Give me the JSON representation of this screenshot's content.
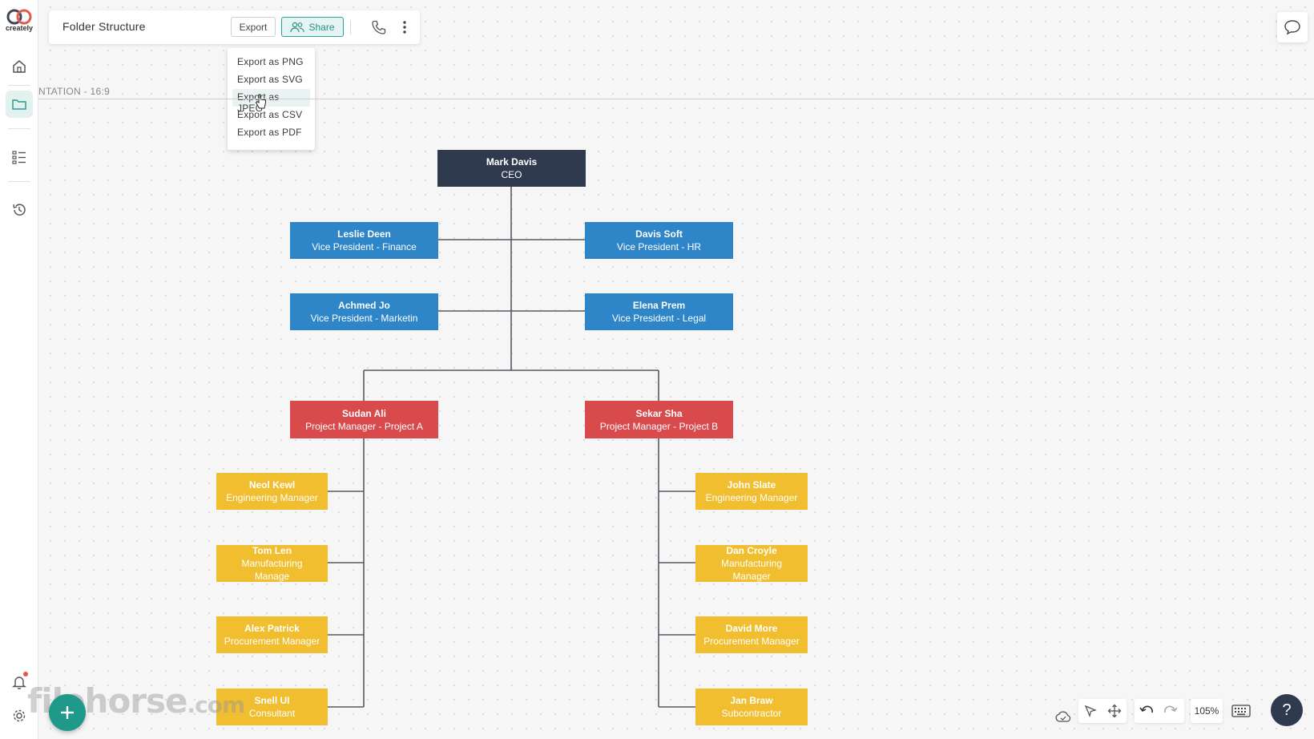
{
  "app": {
    "logo_text": "creately",
    "brand_color": "#1f9a8a"
  },
  "toolbar": {
    "title": "Folder Structure",
    "export_label": "Export",
    "share_label": "Share"
  },
  "export_menu": {
    "items": [
      {
        "label": "Export as PNG"
      },
      {
        "label": "Export as SVG"
      },
      {
        "label": "Export as JPEG",
        "hovered": true
      },
      {
        "label": "Export as CSV"
      },
      {
        "label": "Export as PDF"
      }
    ]
  },
  "canvas": {
    "presentation_label": "NTATION - 16:9"
  },
  "org_chart": {
    "ceo": {
      "name": "Mark Davis",
      "title": "CEO"
    },
    "vps": [
      {
        "name": "Leslie Deen",
        "title": "Vice President - Finance"
      },
      {
        "name": "Davis Soft",
        "title": "Vice President - HR"
      },
      {
        "name": "Achmed Jo",
        "title": "Vice President - Marketin"
      },
      {
        "name": "Elena Prem",
        "title": "Vice President - Legal"
      }
    ],
    "pms": [
      {
        "name": "Sudan Ali",
        "title": "Project Manager - Project A"
      },
      {
        "name": "Sekar Sha",
        "title": "Project Manager - Project B"
      }
    ],
    "team_a": [
      {
        "name": "Neol Kewl",
        "title": "Engineering Manager"
      },
      {
        "name": "Tom Len",
        "title": "Manufacturing Manage"
      },
      {
        "name": "Alex Patrick",
        "title": "Procurement Manager"
      },
      {
        "name": "Snell UI",
        "title": "Consultant"
      }
    ],
    "team_b": [
      {
        "name": "John Slate",
        "title": "Engineering Manager"
      },
      {
        "name": "Dan Croyle",
        "title": "Manufacturing Manager"
      },
      {
        "name": "David More",
        "title": "Procurement Manager"
      },
      {
        "name": "Jan Braw",
        "title": "Subcontractor"
      }
    ],
    "colors": {
      "ceo": "#2f3a4f",
      "vp": "#2e86c9",
      "pm": "#d94a4d",
      "manager": "#f0be2f",
      "connector": "#555a63"
    }
  },
  "bottom_controls": {
    "zoom": "105%",
    "help_label": "?"
  },
  "watermark": {
    "text": "filehorse",
    "suffix": ".com"
  }
}
